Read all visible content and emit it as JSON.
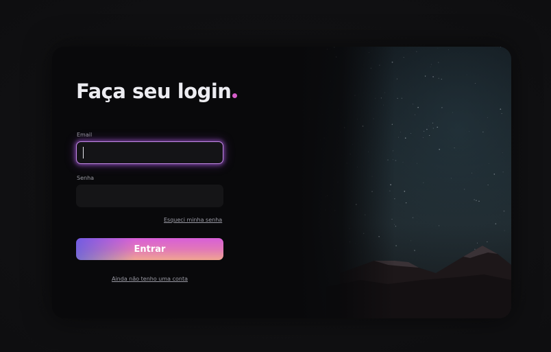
{
  "login": {
    "title": "Faça seu login",
    "email_label": "Email",
    "email_value": "",
    "password_label": "Senha",
    "password_value": "",
    "forgot_link": "Esqueci minha senha",
    "submit_label": "Entrar",
    "signup_link": "Ainda não tenho uma conta"
  },
  "colors": {
    "accent": "#d65dca",
    "card_background": "#09090b",
    "input_background": "#151517",
    "focus_ring": "#c48ae8",
    "button_gradient": [
      "#5a5ae6",
      "#d85fd8",
      "#f0a592"
    ]
  },
  "icons": {
    "title_decoration": "dot-icon",
    "hero_image": "starry-mountains-image"
  }
}
